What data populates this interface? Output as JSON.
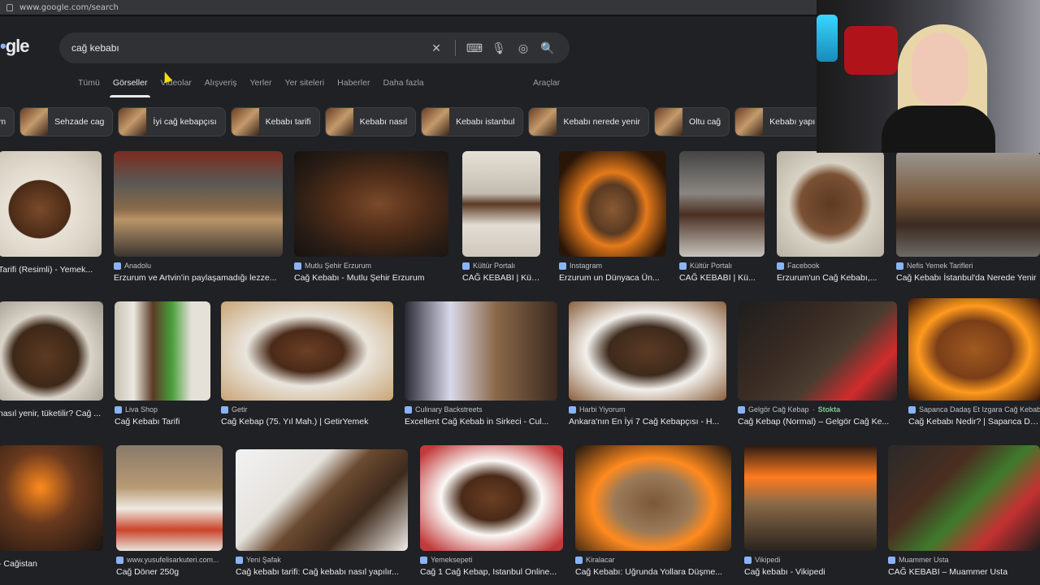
{
  "browser": {
    "url": "www.google.com/search"
  },
  "logo": {
    "text_visible": "gle"
  },
  "search": {
    "query": "cağ kebabı"
  },
  "tabs": [
    "Tümü",
    "Görseller",
    "Videolar",
    "Alışveriş",
    "Yerler",
    "Yer siteleri",
    "Haberler",
    "Daha fazla"
  ],
  "active_tab": "Görseller",
  "tools_label": "Araçlar",
  "chips": [
    "rum",
    "Sehzade cag",
    "İyi cağ kebapçısı",
    "Kebabı tarifi",
    "Kebabı nasıl",
    "Kebabı istanbul",
    "Kebabı nerede yenir",
    "Oltu cağ",
    "Kebabı yapı"
  ],
  "results": [
    {
      "source": "",
      "title": "Tarifi (Resimli) - Yemek..."
    },
    {
      "source": "Anadolu",
      "title": "Erzurum ve Artvin'in paylaşamadığı lezze..."
    },
    {
      "source": "Mutlu Şehir Erzurum",
      "title": "Cağ Kebabı - Mutlu Şehir Erzurum"
    },
    {
      "source": "Kültür Portalı",
      "title": "CAĞ KEBABI | Kül..."
    },
    {
      "source": "Instagram",
      "title": "Erzurum un Dünyaca Ün..."
    },
    {
      "source": "Kültür Portalı",
      "title": "CAĞ KEBABI | Kü..."
    },
    {
      "source": "Facebook",
      "title": "Erzurum'un Cağ Kebabı,..."
    },
    {
      "source": "Nefis Yemek Tarifleri",
      "title": "Cağ Kebabı İstanbul'da Nerede Yenir"
    },
    {
      "source": "",
      "title": "nasıl yenir, tüketilir? Cağ ..."
    },
    {
      "source": "Liva Shop",
      "title": "Cağ Kebabı Tarifi"
    },
    {
      "source": "Getir",
      "title": "Cağ Kebap (75. Yıl Mah.) | GetirYemek"
    },
    {
      "source": "Culinary Backstreets",
      "title": "Excellent Cağ Kebab in Sirkeci - Cul..."
    },
    {
      "source": "Harbi Yiyorum",
      "title": "Ankara'nın En İyi 7 Cağ Kebapçısı - H..."
    },
    {
      "source": "Gelgör Cağ Kebap",
      "stock": "Stokta",
      "title": "Cağ Kebap (Normal) – Gelgör Cağ Ke..."
    },
    {
      "source": "Sapanca Dadaş Et Izgara Cağ Kebab",
      "title": "Cağ Kebabı Nedir? | Sapanca Da..."
    },
    {
      "source": "",
      "title": "- Cağistan"
    },
    {
      "source": "www.yusufelisarkuteri.com...",
      "title": "Cağ Döner 250g"
    },
    {
      "source": "Yeni Şafak",
      "title": "Cağ kebabı tarifi: Cağ kebabı nasıl yapılır..."
    },
    {
      "source": "Yemeksepeti",
      "title": "Cağ 1 Cağ Kebap, Istanbul Online..."
    },
    {
      "source": "Kiralacar",
      "title": "Cağ Kebabı: Uğrunda Yollara Düşme..."
    },
    {
      "source": "Vikipedi",
      "title": "Cağ kebabı - Vikipedi"
    },
    {
      "source": "Muammer Usta",
      "title": "CAĞ KEBABI – Muammer Usta"
    }
  ],
  "colors": {
    "background": "#202124",
    "search_box": "#303134",
    "link_accent": "#8ab4f8",
    "stock_green": "#81c995"
  },
  "icons": [
    "clear-icon",
    "keyboard-icon",
    "mic-icon",
    "lens-icon",
    "search-icon"
  ]
}
